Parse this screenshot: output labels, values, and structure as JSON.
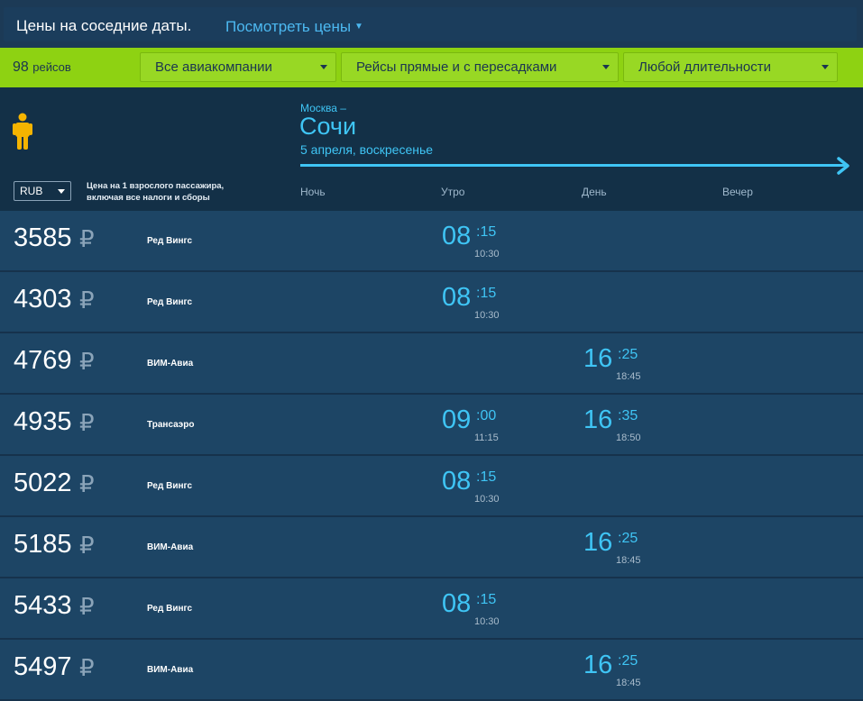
{
  "top": {
    "title": "Цены на соседние даты.",
    "link": "Посмотреть цены"
  },
  "filters": {
    "count": "98",
    "count_unit": "рейсов",
    "airlines": "Все авиакомпании",
    "stops": "Рейсы прямые и с пересадками",
    "duration": "Любой длительности"
  },
  "header": {
    "currency": "RUB",
    "note": "Цена на 1 взрослого пассажира, включая все налоги и сборы",
    "from": "Москва –",
    "to": "Сочи",
    "date": "5 апреля, воскресенье",
    "slots": [
      "Ночь",
      "Утро",
      "День",
      "Вечер"
    ]
  },
  "currency_sign": "₽",
  "colors": {
    "accent": "#3fc5f5",
    "filter_bar": "#8ed212",
    "row_bg": "#1d4565",
    "person_icon": "#f5b400"
  },
  "flights": [
    {
      "price": "3585",
      "airline": "Ред Вингс",
      "slot": "Утро",
      "dep_h": "08",
      "dep_m": ":15",
      "arr": "10:30"
    },
    {
      "price": "4303",
      "airline": "Ред Вингс",
      "slot": "Утро",
      "dep_h": "08",
      "dep_m": ":15",
      "arr": "10:30"
    },
    {
      "price": "4769",
      "airline": "ВИМ-Авиа",
      "slot": "День",
      "dep_h": "16",
      "dep_m": ":25",
      "arr": "18:45"
    },
    {
      "price": "4935",
      "airline": "Трансаэро",
      "slot": "Утро",
      "dep_h": "09",
      "dep_m": ":00",
      "arr": "11:15",
      "slot2": "День",
      "dep2_h": "16",
      "dep2_m": ":35",
      "arr2": "18:50"
    },
    {
      "price": "5022",
      "airline": "Ред Вингс",
      "slot": "Утро",
      "dep_h": "08",
      "dep_m": ":15",
      "arr": "10:30"
    },
    {
      "price": "5185",
      "airline": "ВИМ-Авиа",
      "slot": "День",
      "dep_h": "16",
      "dep_m": ":25",
      "arr": "18:45"
    },
    {
      "price": "5433",
      "airline": "Ред Вингс",
      "slot": "Утро",
      "dep_h": "08",
      "dep_m": ":15",
      "arr": "10:30"
    },
    {
      "price": "5497",
      "airline": "ВИМ-Авиа",
      "slot": "День",
      "dep_h": "16",
      "dep_m": ":25",
      "arr": "18:45"
    }
  ]
}
